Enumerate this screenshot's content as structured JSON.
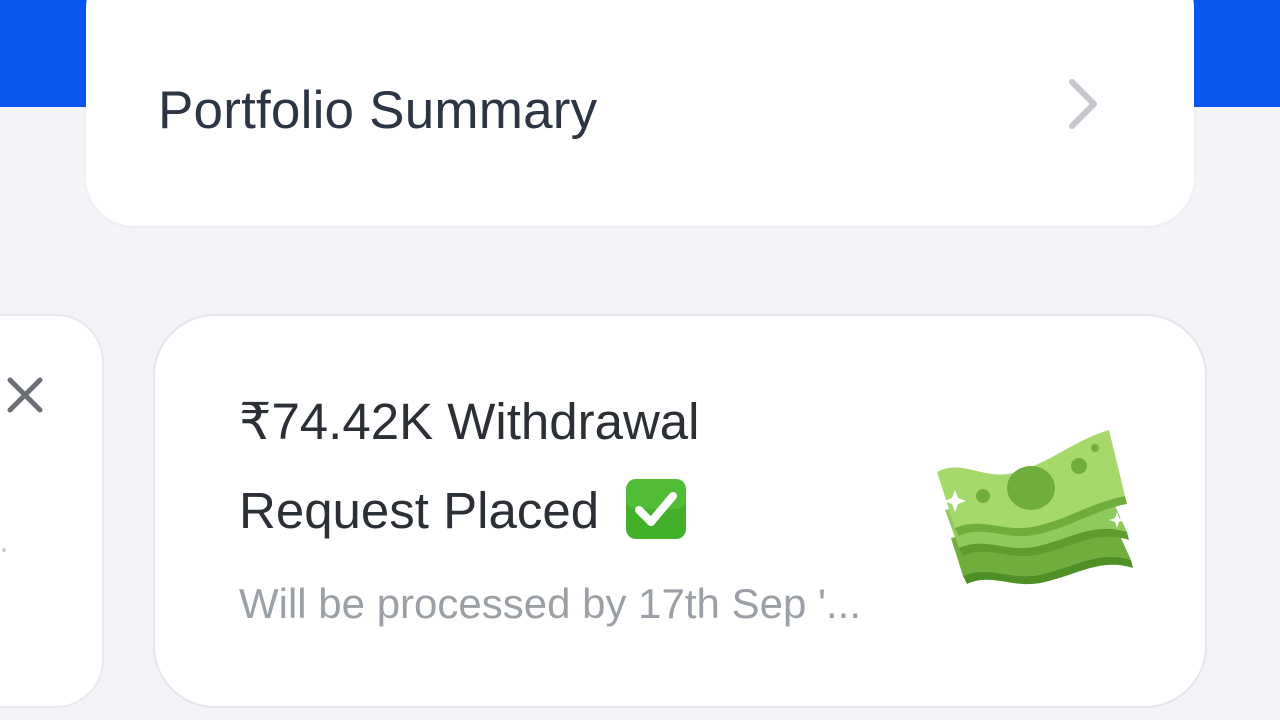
{
  "summary": {
    "title": "Portfolio Summary",
    "chevron_icon": "chevron-right-icon"
  },
  "left_card": {
    "close_icon": "close-icon"
  },
  "withdrawal": {
    "amount_line": "₹74.42K Withdrawal",
    "status_line": "Request Placed",
    "status_icon": "check-mark-button-icon",
    "subtitle": "Will be processed by 17th Sep '...",
    "illustration_icon": "money-with-wings-icon"
  },
  "colors": {
    "brand_blue": "#0a55f0",
    "page_background": "#f3f4f7",
    "card_background": "#ffffff",
    "title_text": "#2c3544",
    "subtitle_text": "#9aa0a6",
    "check_green": "#43b02a",
    "money_green": "#8fcb5c"
  }
}
